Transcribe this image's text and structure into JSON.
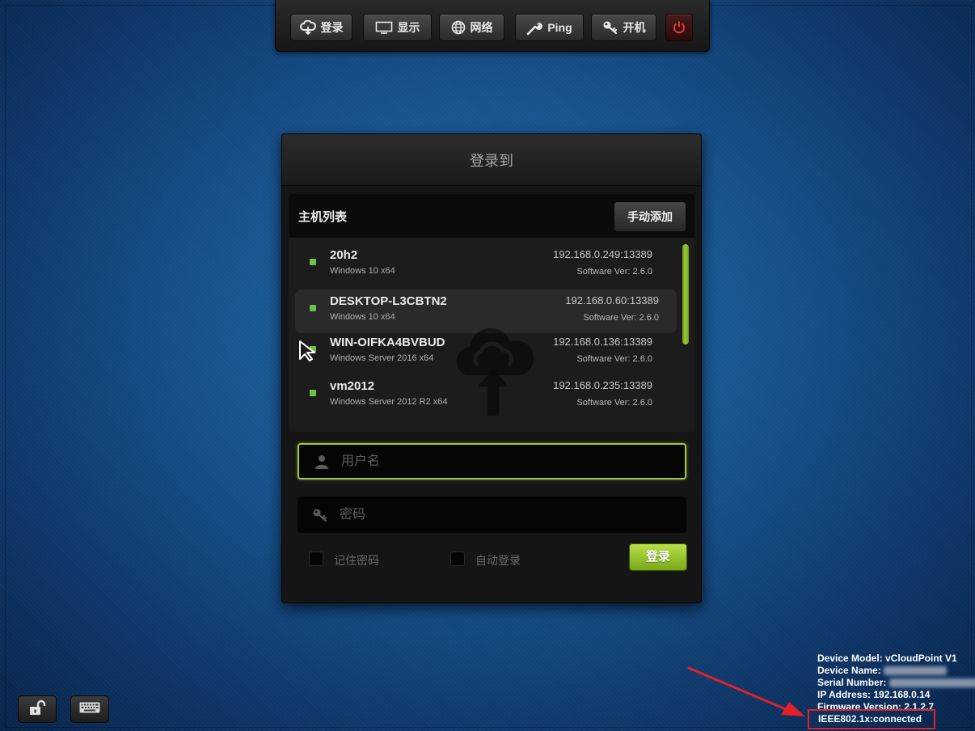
{
  "toolbar": {
    "login_label": "登录",
    "display_label": "显示",
    "network_label": "网络",
    "ping_label": "Ping",
    "wake_label": "开机"
  },
  "panel": {
    "title": "登录到",
    "host_list_title": "主机列表",
    "manual_add_label": "手动添加"
  },
  "hosts": [
    {
      "name": "20h2",
      "os": "Windows 10 x64",
      "address": "192.168.0.249:13389",
      "version": "Software Ver: 2.6.0",
      "status_color": "#6ec24a"
    },
    {
      "name": "DESKTOP-L3CBTN2",
      "os": "Windows 10 x64",
      "address": "192.168.0.60:13389",
      "version": "Software Ver: 2.6.0",
      "status_color": "#6ec24a"
    },
    {
      "name": "WIN-OIFKA4BVBUD",
      "os": "Windows Server 2016 x64",
      "address": "192.168.0.136:13389",
      "version": "Software Ver: 2.6.0",
      "status_color": "#6ec24a"
    },
    {
      "name": "vm2012",
      "os": "Windows Server 2012 R2 x64",
      "address": "192.168.0.235:13389",
      "version": "Software Ver: 2.6.0",
      "status_color": "#6ec24a"
    }
  ],
  "form": {
    "username_placeholder": "用户名",
    "username_value": "",
    "password_placeholder": "密码",
    "password_value": "",
    "remember_label": "记住密码",
    "auto_login_label": "自动登录",
    "login_button_label": "登录"
  },
  "device": {
    "model": "Device Model: vCloudPoint V1",
    "name_label": "Device Name:",
    "serial_label": "Serial Number:",
    "ip": "IP Address: 192.168.0.14",
    "firmware": "Firmware Version: 2.1.2.7",
    "ieee": "IEEE802.1x:connected"
  },
  "colors": {
    "accent_green": "#a5c93a",
    "status_green": "#6ec24a",
    "highlight_red": "#e2202a",
    "annotation_arrow": "#e2202a"
  },
  "icons": {
    "login": "cloud-login-icon",
    "display": "monitor-icon",
    "network": "globe-icon",
    "ping": "wrench-icon",
    "wake": "key-icon",
    "power": "power-icon",
    "username": "user-icon",
    "password": "key-icon",
    "unlock": "unlock-icon",
    "keyboard": "keyboard-icon"
  }
}
